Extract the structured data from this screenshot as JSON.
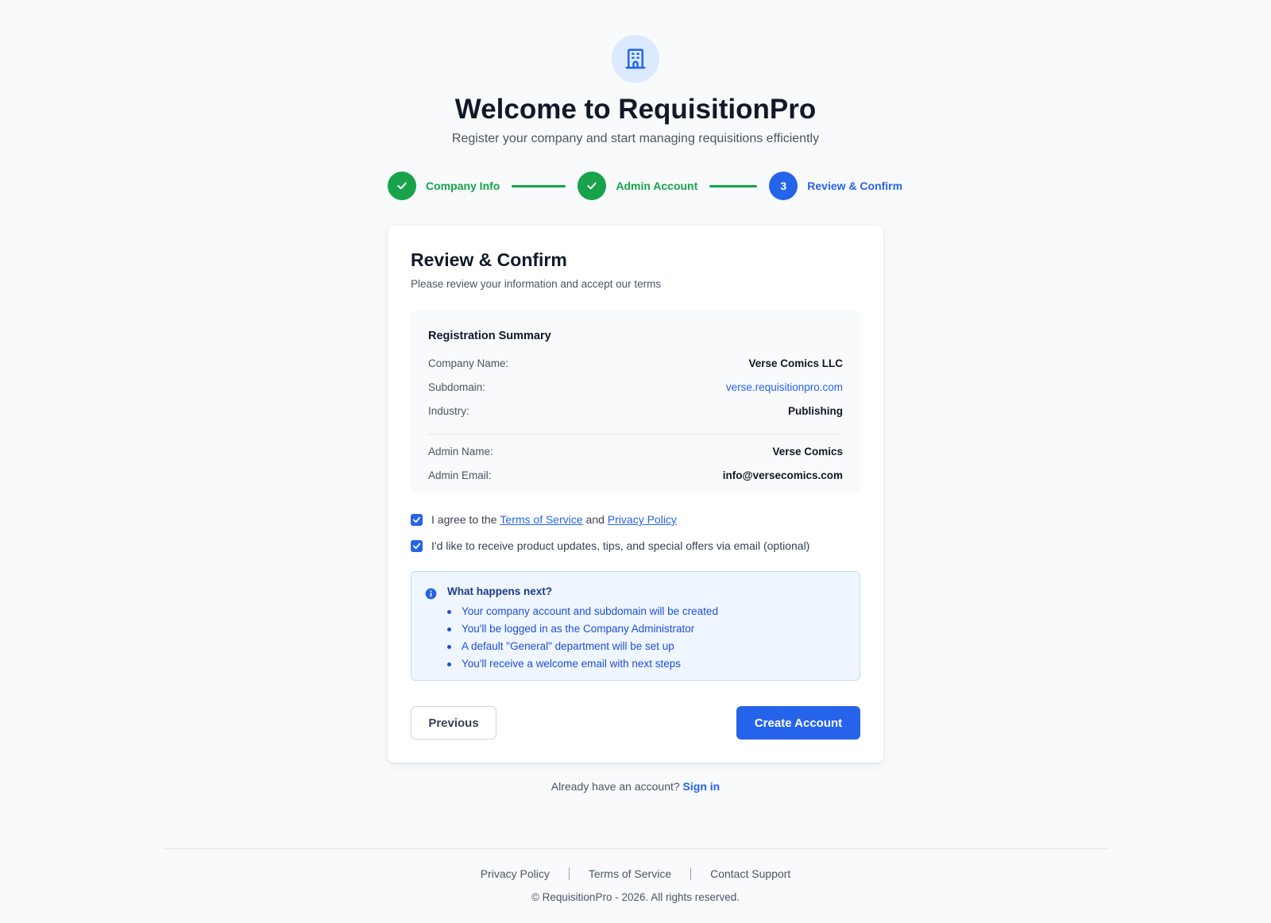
{
  "header": {
    "logo_icon": "building-icon",
    "title": "Welcome to RequisitionPro",
    "subtitle": "Register your company and start managing requisitions efficiently"
  },
  "stepper": {
    "steps": [
      {
        "label": "Company Info",
        "state": "completed",
        "icon": "check-icon"
      },
      {
        "label": "Admin Account",
        "state": "completed",
        "icon": "check-icon"
      },
      {
        "label": "Review & Confirm",
        "state": "active",
        "number": "3"
      }
    ]
  },
  "card": {
    "title": "Review & Confirm",
    "subtitle": "Please review your information and accept our terms",
    "summary": {
      "title": "Registration Summary",
      "rows": [
        {
          "label": "Company Name:",
          "value": "Verse Comics LLC"
        },
        {
          "label": "Subdomain:",
          "value": "verse.requisitionpro.com"
        },
        {
          "label": "Industry:",
          "value": "Publishing"
        },
        {
          "label": "Admin Name:",
          "value": "Verse Comics"
        },
        {
          "label": "Admin Email:",
          "value": "info@versecomics.com"
        }
      ]
    },
    "terms": {
      "checked": true,
      "prefix": "I agree to the",
      "terms_link": "Terms of Service",
      "conjunction": "and",
      "privacy_link": "Privacy Policy"
    },
    "marketing": {
      "checked": true,
      "label": "I'd like to receive product updates, tips, and special offers via email (optional)"
    },
    "info": {
      "title": "What happens next?",
      "items": [
        "Your company account and subdomain will be created",
        "You'll be logged in as the Company Administrator",
        "A default \"General\" department will be set up",
        "You'll receive a welcome email with next steps"
      ]
    },
    "buttons": {
      "previous": "Previous",
      "create": "Create Account"
    }
  },
  "signin": {
    "prompt": "Already have an account?",
    "link": "Sign in"
  },
  "footer": {
    "links": [
      "Privacy Policy",
      "Terms of Service",
      "Contact Support"
    ],
    "copyright": "© RequisitionPro - 2026. All rights reserved."
  },
  "colors": {
    "primary": "#2563eb",
    "success": "#16a34a",
    "background": "#f8fafc",
    "info_bg": "#eff6ff"
  }
}
